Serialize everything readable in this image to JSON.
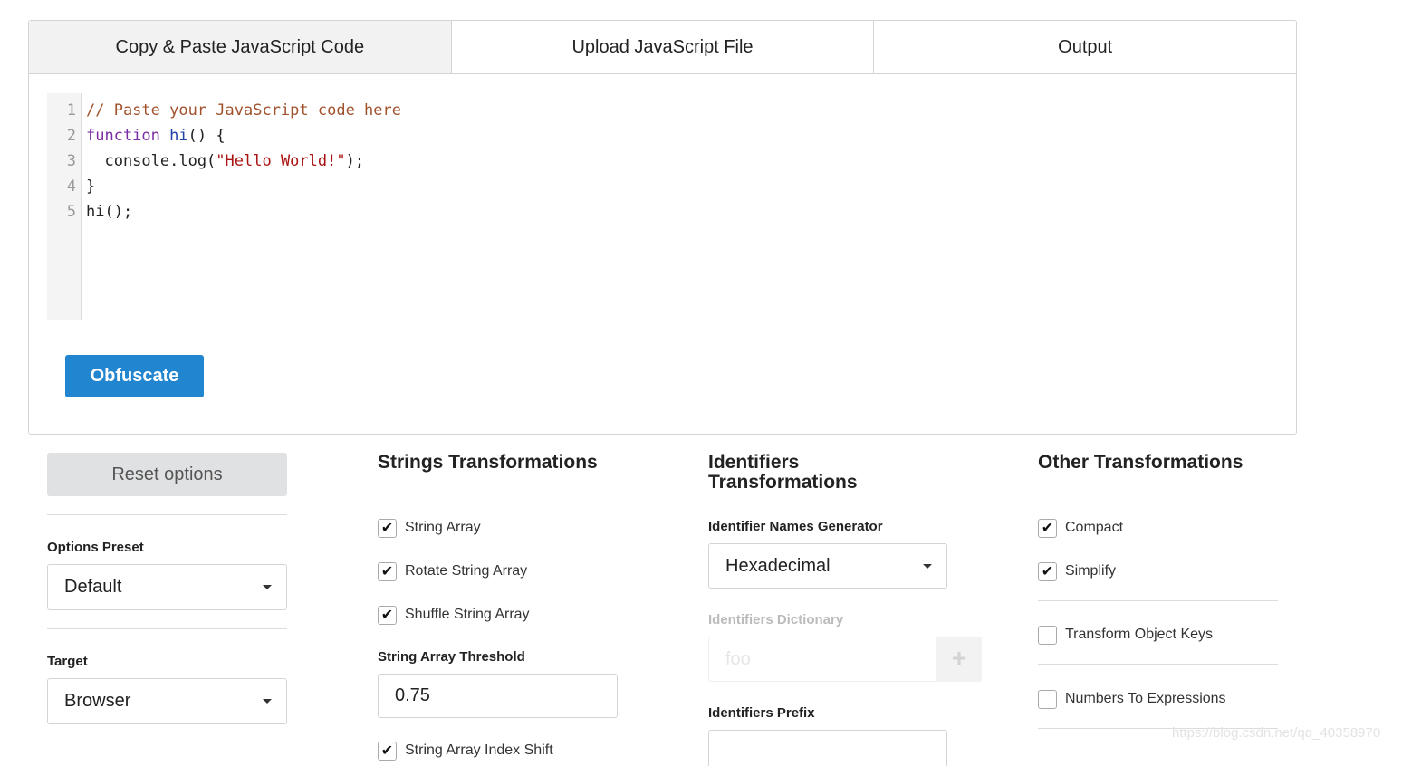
{
  "tabs": [
    {
      "label": "Copy & Paste JavaScript Code",
      "active": true
    },
    {
      "label": "Upload JavaScript File",
      "active": false
    },
    {
      "label": "Output",
      "active": false
    }
  ],
  "editor": {
    "line_numbers": [
      "1",
      "2",
      "3",
      "4",
      "5"
    ],
    "lines": [
      [
        {
          "t": "// Paste your JavaScript code here",
          "c": "comment"
        }
      ],
      [
        {
          "t": "function",
          "c": "keyword"
        },
        {
          "t": " "
        },
        {
          "t": "hi",
          "c": "def"
        },
        {
          "t": "() {"
        }
      ],
      [
        {
          "t": "  console.log("
        },
        {
          "t": "\"Hello World!\"",
          "c": "string"
        },
        {
          "t": ");"
        }
      ],
      [
        {
          "t": "}"
        }
      ],
      [
        {
          "t": "hi();"
        }
      ]
    ]
  },
  "obfuscate_label": "Obfuscate",
  "options": {
    "reset_label": "Reset options",
    "preset_label": "Options Preset",
    "preset_value": "Default",
    "target_label": "Target",
    "target_value": "Browser"
  },
  "strings": {
    "heading": "Strings Transformations",
    "checks": [
      {
        "label": "String Array",
        "checked": true
      },
      {
        "label": "Rotate String Array",
        "checked": true
      },
      {
        "label": "Shuffle String Array",
        "checked": true
      }
    ],
    "threshold_label": "String Array Threshold",
    "threshold_value": "0.75",
    "index_shift_label": "String Array Index Shift"
  },
  "identifiers": {
    "heading": "Identifiers Transformations",
    "generator_label": "Identifier Names Generator",
    "generator_value": "Hexadecimal",
    "dictionary_label": "Identifiers Dictionary",
    "dictionary_placeholder": "foo",
    "prefix_label": "Identifiers Prefix"
  },
  "other": {
    "heading": "Other Transformations",
    "checks": [
      {
        "label": "Compact",
        "checked": true
      },
      {
        "label": "Simplify",
        "checked": true
      },
      {
        "label": "Transform Object Keys",
        "checked": false
      },
      {
        "label": "Numbers To Expressions",
        "checked": false
      }
    ]
  },
  "icons": {
    "check": "check-icon",
    "caret": "caret-down-icon",
    "plus": "plus-icon"
  },
  "colors": {
    "primary": "#2185d0",
    "reset_bg": "#e0e1e2",
    "active_tab": "#f2f2f2"
  },
  "watermark": "https://blog.csdn.net/qq_40358970"
}
